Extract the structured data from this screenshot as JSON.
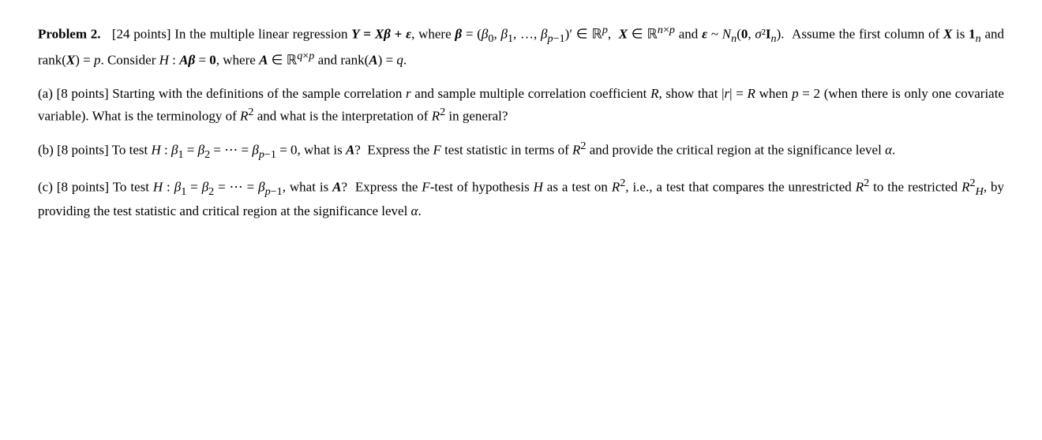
{
  "problem": {
    "number": "2",
    "points_total": "24",
    "header": "Problem 2.",
    "header_desc": "[24 points] In the multiple linear regression",
    "equation_main": "Y = Xβ + ε",
    "where_beta": "where β =",
    "beta_def": "(β₀, β₁, …, β_{p-1})′ ∈ ℝᵖ,",
    "X_def": "X ∈ ℝⁿˣᵖ",
    "and_eps": "and ε ~ N_n(0, σ²I_n).",
    "assume": "Assume the first column of",
    "X_is": "X is 1_n and rank(X) = p.",
    "consider": "Consider H : Aβ = 0, where A ∈ ℝ^{q×p} and rank(A) = q.",
    "part_a": {
      "label": "(a)",
      "points": "[8 points]",
      "text": "Starting with the definitions of the sample correlation r and sample multiple correlation coefficient R, show that |r| = R when p = 2 (when there is only one covariate variable). What is the terminology of R² and what is the interpretation of R² in general?"
    },
    "part_b": {
      "label": "(b)",
      "points": "[8 points]",
      "text": "To test H : β₁ = β₂ = ⋯ = β_{p-1} = 0, what is A? Express the F test statistic in terms of R² and provide the critical region at the significance level α."
    },
    "part_c": {
      "label": "(c)",
      "points": "[8 points]",
      "text": "To test H : β₁ = β₂ = ⋯ = β_{p-1}, what is A? Express the F-test of hypothesis H as a test on R², i.e., a test that compares the unrestricted R² to the restricted R²_H, by providing the test statistic and critical region at the significance level α."
    }
  }
}
